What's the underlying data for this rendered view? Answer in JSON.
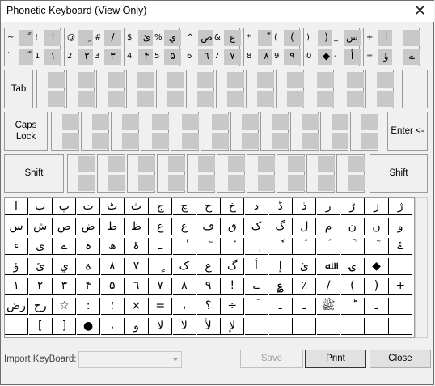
{
  "window": {
    "title": "Phonetic Keyboard (View Only)",
    "close_glyph": "✕"
  },
  "keyboard": {
    "row1": [
      [
        "~",
        "ً",
        "!",
        "!"
      ],
      [
        "@",
        "ِ",
        "#",
        "/"
      ],
      [
        "$",
        "ئ",
        "%",
        "ي"
      ],
      [
        "^",
        "ص",
        "&",
        "ع"
      ],
      [
        "*",
        "ّ",
        "(",
        "("
      ],
      [
        ")",
        ")",
        "_",
        "س"
      ],
      [
        "+",
        "آ",
        "",
        ""
      ],
      [
        "`",
        "ّ",
        "1",
        "۱"
      ],
      [
        "2",
        "۲",
        "3",
        "۳"
      ],
      [
        "4",
        "۴",
        "5",
        "۵"
      ],
      [
        "6",
        "٦",
        "7",
        "۷"
      ],
      [
        "8",
        "۸",
        "9",
        "۹"
      ],
      [
        "0",
        "◆",
        "-",
        "أ"
      ],
      [
        "=",
        "ؤ",
        "",
        "ے"
      ]
    ],
    "tab": "Tab",
    "caps": "Caps Lock",
    "enter": "Enter <-",
    "shift_left": "Shift",
    "shift_right": "Shift"
  },
  "palette": [
    [
      "ا",
      "ب",
      "پ",
      "ت",
      "ٹ",
      "ث",
      "ج",
      "چ",
      "ح",
      "خ",
      "د",
      "ڈ",
      "ذ",
      "ر",
      "ڑ",
      "ز",
      "ژ"
    ],
    [
      "س",
      "ش",
      "ص",
      "ض",
      "ط",
      "ظ",
      "ع",
      "غ",
      "ف",
      "ق",
      "ک",
      "گ",
      "ل",
      "م",
      "ن",
      "ں",
      "و"
    ],
    [
      "ء",
      "ی",
      "ے",
      "ہ",
      "ھ",
      "ۃ",
      "ـ",
      "ٰ",
      "ٓ",
      "ٔ",
      "ٖ",
      "ٗ",
      "ؐ",
      "ؑ",
      "ؒ",
      "ؓ",
      "ۓ"
    ],
    [
      "ؤ",
      "ئ",
      "ي",
      "ة",
      "۸",
      "۷",
      "ٍ",
      "ک",
      "ع",
      "گ",
      "أ",
      "إ",
      "ئ",
      "ﷲ",
      "ۍ",
      "◆",
      ""
    ],
    [
      "۱",
      "۲",
      "۳",
      "۴",
      "۵",
      "٦",
      "۷",
      "۸",
      "۹",
      "!",
      "؎",
      "؏",
      "٪",
      "/",
      "(",
      ")",
      "+"
    ],
    [
      "رض",
      "رح",
      "☆",
      ":",
      "؛",
      "×",
      "=",
      "،",
      "؟",
      "÷",
      "ؔ",
      "ـ",
      "ـ",
      "ﷺ",
      "ؕ",
      "ـ",
      ""
    ],
    [
      "",
      "[",
      "]",
      "●",
      "،",
      "و",
      "لا",
      "لآ",
      "لأ",
      "لإ",
      "",
      "",
      "",
      "",
      "",
      "",
      ""
    ]
  ],
  "footer": {
    "import_label": "Import KeyBoard:",
    "save": "Save",
    "print": "Print",
    "close": "Close"
  }
}
